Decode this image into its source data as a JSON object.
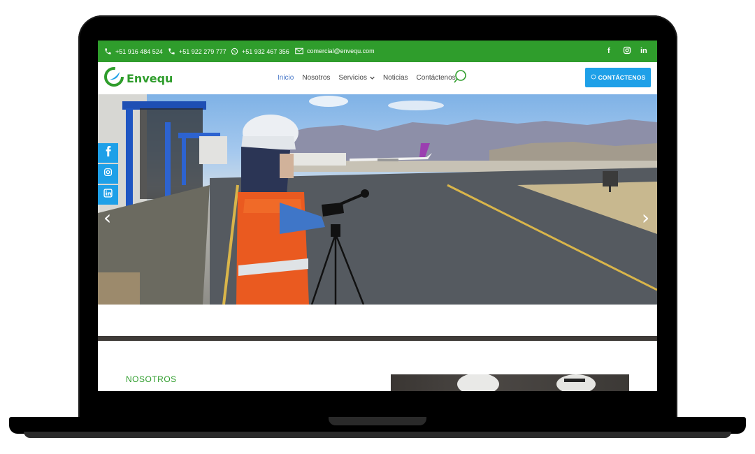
{
  "topbar": {
    "phone1": "+51 916 484 524",
    "phone2": "+51 922 279 777",
    "whatsapp": "+51 932 467 356",
    "email": "comercial@envequ.com",
    "social": [
      "f",
      "in"
    ]
  },
  "navbar": {
    "logo_text": "Envequ",
    "items": [
      "Inicio",
      "Nosotros",
      "Servicios",
      "Noticias",
      "Contáctenos"
    ],
    "cta_label": "CONTÁCTENOS"
  },
  "hero": {
    "prev_arrow": "‹",
    "next_arrow": "›"
  },
  "section": {
    "title": "NOSOTROS"
  },
  "colors": {
    "brand_green": "#2f9d2c",
    "accent_blue": "#1ea0e8",
    "nav_active": "#4a79c9"
  },
  "icons": [
    "phone-icon",
    "whatsapp-icon",
    "mail-icon",
    "facebook-icon",
    "instagram-icon",
    "linkedin-icon",
    "search-icon",
    "chevron-down-icon"
  ]
}
